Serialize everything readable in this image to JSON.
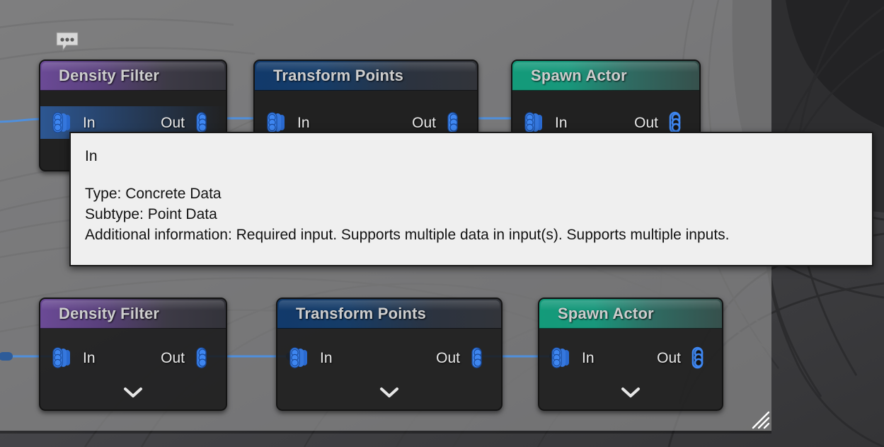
{
  "app": {
    "context": "pcg-graph-editor"
  },
  "graph": {
    "comment_icon": "comment-bubble-icon",
    "resize_grip_icon": "resize-grip-icon",
    "wire_color": "#4f8fdc",
    "pin_color": "#3e86f0"
  },
  "nodes": [
    {
      "id": "density-filter-top",
      "title": "Density Filter",
      "header_color": "#6b4a96",
      "header_style": "purple",
      "in_label": "In",
      "out_label": "Out",
      "in_pin_icon": "multi-data-pin-icon",
      "out_pin_icon": "data-pin-icon",
      "in_pin_hovered": true,
      "out_pin_connected": true,
      "has_chevron": false
    },
    {
      "id": "transform-points-top",
      "title": "Transform Points",
      "header_color": "#123a6b",
      "header_style": "blue",
      "in_label": "In",
      "out_label": "Out",
      "in_pin_icon": "multi-data-pin-icon",
      "out_pin_icon": "data-pin-icon",
      "in_pin_hovered": false,
      "out_pin_connected": true,
      "has_chevron": false
    },
    {
      "id": "spawn-actor-top",
      "title": "Spawn Actor",
      "header_color": "#139b7a",
      "header_style": "teal",
      "in_label": "In",
      "out_label": "Out",
      "in_pin_icon": "multi-data-pin-icon",
      "out_pin_icon": "data-pin-icon-hollow",
      "in_pin_hovered": false,
      "out_pin_connected": false,
      "has_chevron": false
    },
    {
      "id": "density-filter-bottom",
      "title": "Density Filter",
      "header_color": "#6b4a96",
      "header_style": "purple",
      "in_label": "In",
      "out_label": "Out",
      "in_pin_icon": "multi-data-pin-icon",
      "out_pin_icon": "data-pin-icon",
      "in_pin_hovered": false,
      "out_pin_connected": true,
      "has_chevron": true,
      "chevron_icon": "chevron-down-icon"
    },
    {
      "id": "transform-points-bottom",
      "title": "Transform Points",
      "header_color": "#123a6b",
      "header_style": "blue",
      "in_label": "In",
      "out_label": "Out",
      "in_pin_icon": "multi-data-pin-icon",
      "out_pin_icon": "data-pin-icon",
      "in_pin_hovered": false,
      "out_pin_connected": true,
      "has_chevron": true,
      "chevron_icon": "chevron-down-icon"
    },
    {
      "id": "spawn-actor-bottom",
      "title": "Spawn Actor",
      "header_color": "#139b7a",
      "header_style": "teal",
      "in_label": "In",
      "out_label": "Out",
      "in_pin_icon": "multi-data-pin-icon",
      "out_pin_icon": "data-pin-icon-hollow",
      "in_pin_hovered": false,
      "out_pin_connected": false,
      "has_chevron": true,
      "chevron_icon": "chevron-down-icon"
    }
  ],
  "tooltip": {
    "title": "In",
    "type_line": "Type: Concrete Data",
    "subtype_line": "Subtype: Point Data",
    "additional_line": "Additional information: Required input. Supports multiple data in input(s). Supports multiple inputs."
  }
}
